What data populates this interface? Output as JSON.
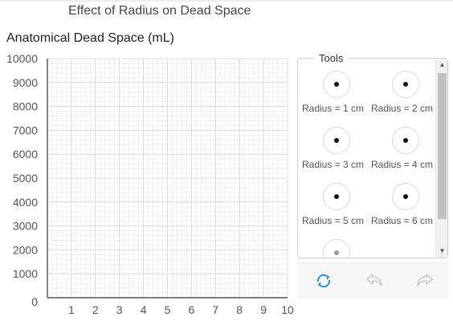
{
  "app": {
    "title": "Effect of Radius on Dead Space"
  },
  "chart_data": {
    "type": "scatter",
    "title": "Effect of Radius on Dead Space",
    "ylabel": "Anatomical Dead Space (mL)",
    "xlabel": "",
    "xlim": [
      0,
      10
    ],
    "ylim": [
      0,
      10000
    ],
    "x_ticks": [
      1,
      2,
      3,
      4,
      5,
      6,
      7,
      8,
      9,
      10
    ],
    "y_ticks": [
      0,
      1000,
      2000,
      3000,
      4000,
      5000,
      6000,
      7000,
      8000,
      9000,
      10000
    ],
    "grid": true,
    "series": []
  },
  "tools": {
    "legend": "Tools",
    "items": [
      {
        "label": "Radius = 1 cm",
        "icon": "point-marker-icon"
      },
      {
        "label": "Radius = 2 cm",
        "icon": "point-marker-icon"
      },
      {
        "label": "Radius = 3 cm",
        "icon": "point-marker-icon"
      },
      {
        "label": "Radius = 4 cm",
        "icon": "point-marker-icon"
      },
      {
        "label": "Radius = 5 cm",
        "icon": "point-marker-icon"
      },
      {
        "label": "Radius = 6 cm",
        "icon": "point-marker-icon"
      },
      {
        "label": "",
        "icon": "point-marker-icon"
      }
    ]
  },
  "actions": {
    "reset_icon": "reset-icon",
    "undo_icon": "undo-icon",
    "redo_icon": "redo-icon",
    "reset_color": "#2f8fd8",
    "disabled_color": "#c8c8c8"
  }
}
